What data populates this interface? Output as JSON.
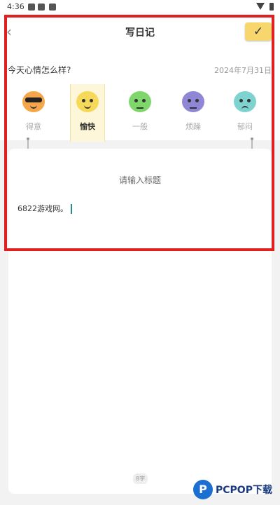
{
  "status_bar": {
    "time": "4:36"
  },
  "header": {
    "title": "写日记",
    "back_icon": "chevron-left-icon",
    "confirm_icon": "check-icon"
  },
  "mood_prompt": {
    "question": "今天心情怎么样?",
    "date": "2024年7月31日"
  },
  "moods": [
    {
      "label": "得意",
      "color": "#f5a54a"
    },
    {
      "label": "愉快",
      "color": "#f7d95a"
    },
    {
      "label": "一般",
      "color": "#7fd66a"
    },
    {
      "label": "烦躁",
      "color": "#8f86d6"
    },
    {
      "label": "郁闷",
      "color": "#7ed3d0"
    }
  ],
  "selected_mood": "愉快",
  "editor": {
    "title_placeholder": "请输入标题",
    "content": "6822游戏网。",
    "char_count": "8字"
  },
  "watermark": {
    "logo": "P",
    "text": "PCPOP下载"
  },
  "colors": {
    "highlight_box": "#e02020",
    "confirm_button": "#f7d66e"
  }
}
